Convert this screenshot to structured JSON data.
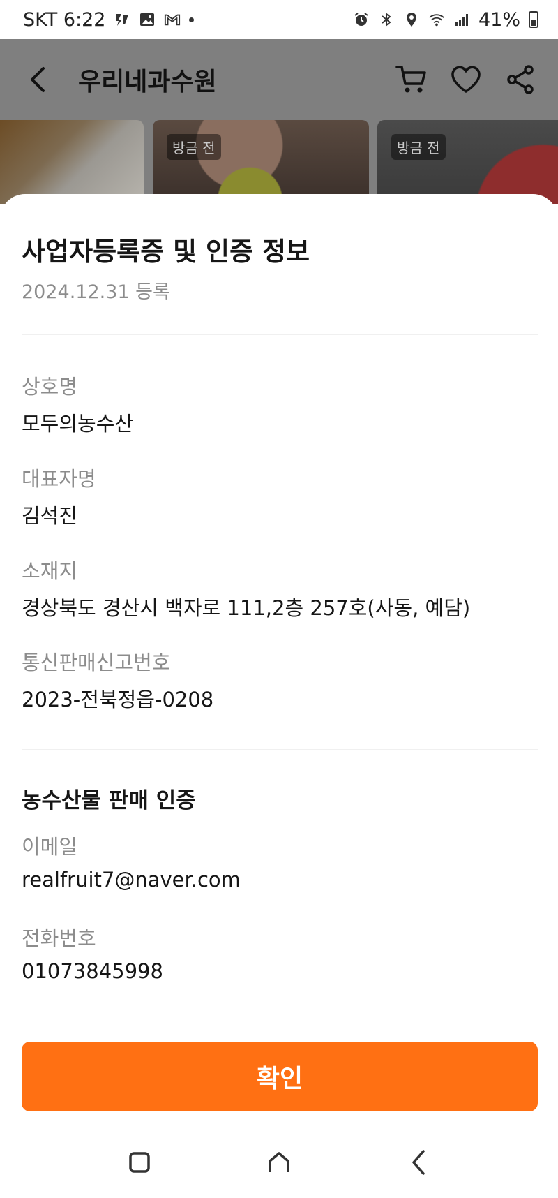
{
  "status_bar": {
    "carrier_time": "SKT 6:22",
    "battery": "41%"
  },
  "header": {
    "title": "우리네과수원"
  },
  "photos": {
    "badge": "방금 전"
  },
  "sheet": {
    "title": "사업자등록증 및 인증 정보",
    "registered_date": "2024.12.31 등록",
    "fields": [
      {
        "label": "상호명",
        "value": "모두의농수산"
      },
      {
        "label": "대표자명",
        "value": "김석진"
      },
      {
        "label": "소재지",
        "value": "경상북도 경산시 백자로 111,2층 257호(사동, 예담)"
      },
      {
        "label": "통신판매신고번호",
        "value": "2023-전북정읍-0208"
      }
    ],
    "cert_section_title": "농수산물 판매 인증",
    "cert_fields": [
      {
        "label": "이메일",
        "value": "realfruit7@naver.com"
      },
      {
        "label": "전화번호",
        "value": "01073845998"
      }
    ],
    "confirm_label": "확인"
  },
  "colors": {
    "accent": "#ff7013",
    "label_gray": "#8c8c8c",
    "overlay": "#7f7f7f"
  }
}
